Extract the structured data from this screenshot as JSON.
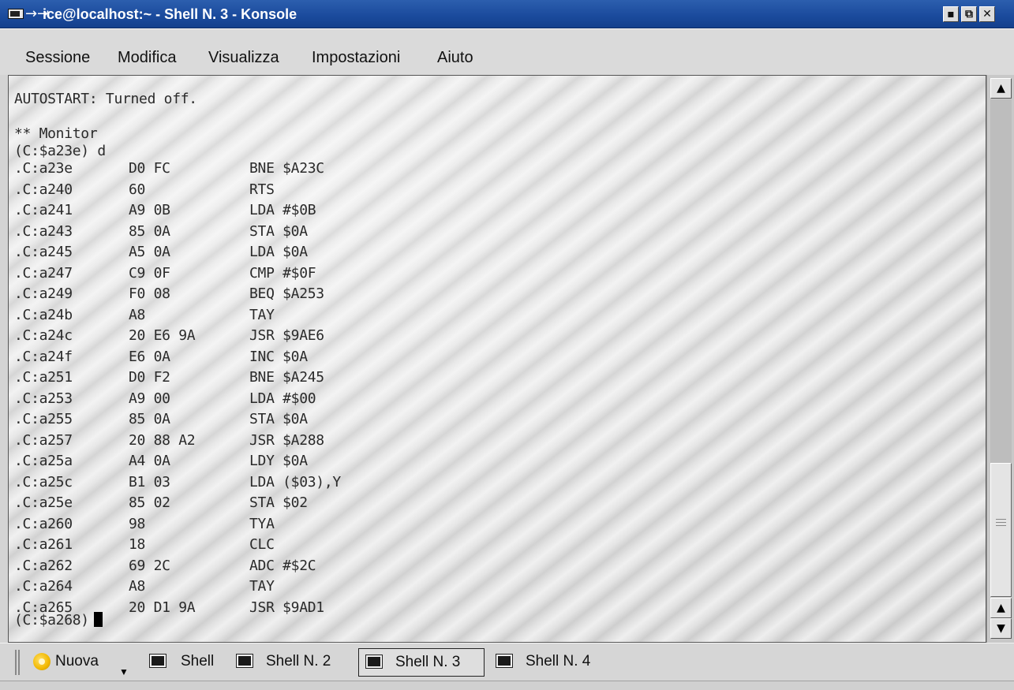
{
  "window": {
    "title": "ice@localhost:~ - Shell N. 3 - Konsole",
    "title_arrows": "→⇥",
    "buttons": {
      "minimize": "▪",
      "maximize": "⧉",
      "close": "✕"
    }
  },
  "menu": {
    "items": [
      "Sessione",
      "Modifica",
      "Visualizza",
      "Impostazioni",
      "Aiuto"
    ]
  },
  "terminal": {
    "header_lines": [
      "AUTOSTART: Turned off.",
      "",
      "** Monitor",
      "(C:$a23e) d"
    ],
    "disassembly": [
      {
        "addr": ".C:a23e",
        "bytes": "D0 FC",
        "asm": "BNE $A23C"
      },
      {
        "addr": ".C:a240",
        "bytes": "60",
        "asm": "RTS"
      },
      {
        "addr": ".C:a241",
        "bytes": "A9 0B",
        "asm": "LDA #$0B"
      },
      {
        "addr": ".C:a243",
        "bytes": "85 0A",
        "asm": "STA $0A"
      },
      {
        "addr": ".C:a245",
        "bytes": "A5 0A",
        "asm": "LDA $0A"
      },
      {
        "addr": ".C:a247",
        "bytes": "C9 0F",
        "asm": "CMP #$0F"
      },
      {
        "addr": ".C:a249",
        "bytes": "F0 08",
        "asm": "BEQ $A253"
      },
      {
        "addr": ".C:a24b",
        "bytes": "A8",
        "asm": "TAY"
      },
      {
        "addr": ".C:a24c",
        "bytes": "20 E6 9A",
        "asm": "JSR $9AE6"
      },
      {
        "addr": ".C:a24f",
        "bytes": "E6 0A",
        "asm": "INC $0A"
      },
      {
        "addr": ".C:a251",
        "bytes": "D0 F2",
        "asm": "BNE $A245"
      },
      {
        "addr": ".C:a253",
        "bytes": "A9 00",
        "asm": "LDA #$00"
      },
      {
        "addr": ".C:a255",
        "bytes": "85 0A",
        "asm": "STA $0A"
      },
      {
        "addr": ".C:a257",
        "bytes": "20 88 A2",
        "asm": "JSR $A288"
      },
      {
        "addr": ".C:a25a",
        "bytes": "A4 0A",
        "asm": "LDY $0A"
      },
      {
        "addr": ".C:a25c",
        "bytes": "B1 03",
        "asm": "LDA ($03),Y"
      },
      {
        "addr": ".C:a25e",
        "bytes": "85 02",
        "asm": "STA $02"
      },
      {
        "addr": ".C:a260",
        "bytes": "98",
        "asm": "TYA"
      },
      {
        "addr": ".C:a261",
        "bytes": "18",
        "asm": "CLC"
      },
      {
        "addr": ".C:a262",
        "bytes": "69 2C",
        "asm": "ADC #$2C"
      },
      {
        "addr": ".C:a264",
        "bytes": "A8",
        "asm": "TAY"
      },
      {
        "addr": ".C:a265",
        "bytes": "20 D1 9A",
        "asm": "JSR $9AD1"
      }
    ],
    "prompt": "(C:$a268)"
  },
  "scrollbar": {
    "up_arrow": "▲",
    "down_arrow": "▼",
    "position_fraction": 0.78
  },
  "tabs": {
    "new_label": "Nuova",
    "new_arrow": "▼",
    "sessions": [
      "Shell",
      "Shell N. 2",
      "Shell N. 3",
      "Shell N. 4"
    ],
    "active_index": 2
  }
}
